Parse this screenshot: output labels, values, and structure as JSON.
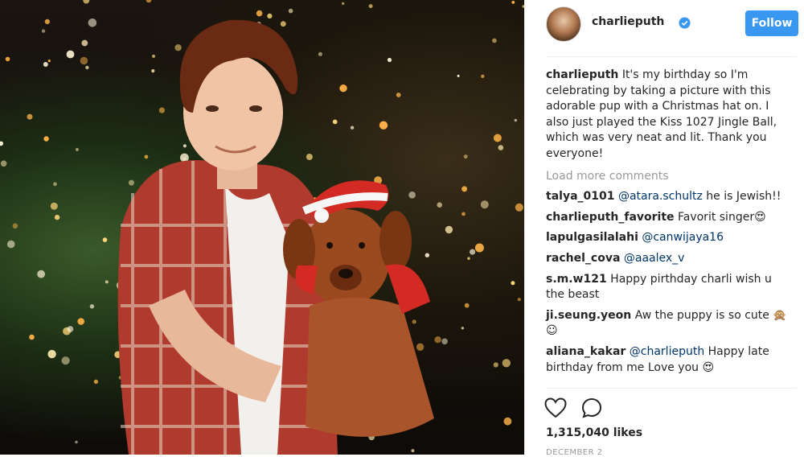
{
  "post": {
    "author": "charlieputh",
    "follow_label": "Follow",
    "caption": "It's my birthday so I'm celebrating by taking a picture with this adorable pup with a Christmas hat on. I also just played the Kiss 1027 Jingle Ball, which was very neat and lit. Thank you everyone!",
    "load_more": "Load more comments",
    "likes": "1,315,040 likes",
    "date": "DECEMBER 2"
  },
  "comments": [
    {
      "user": "talya_0101",
      "mention": "@atara.schultz",
      "text": " he is Jewish!!"
    },
    {
      "user": "charlieputh_favorite",
      "mention": "",
      "text": "Favorit singer😍"
    },
    {
      "user": "lapulgasilalahi",
      "mention": "@canwijaya16",
      "text": ""
    },
    {
      "user": "rachel_cova",
      "mention": "@aaalex_v",
      "text": ""
    },
    {
      "user": "s.m.w121",
      "mention": "",
      "text": "Happy pirthday charli wish u the beast"
    },
    {
      "user": "ji.seung.yeon",
      "mention": "",
      "text": "Aw the puppy is so cute 🙊 ☺"
    },
    {
      "user": "aliana_kakar",
      "mention": "@charlieputh",
      "text": " Happy late birthday from me Love you 😍"
    }
  ],
  "icons": {
    "verified": "verified-badge-icon",
    "like": "heart-icon",
    "comment": "comment-bubble-icon"
  },
  "colors": {
    "follow_button": "#3897f0",
    "mention": "#003569",
    "muted": "#999999"
  }
}
